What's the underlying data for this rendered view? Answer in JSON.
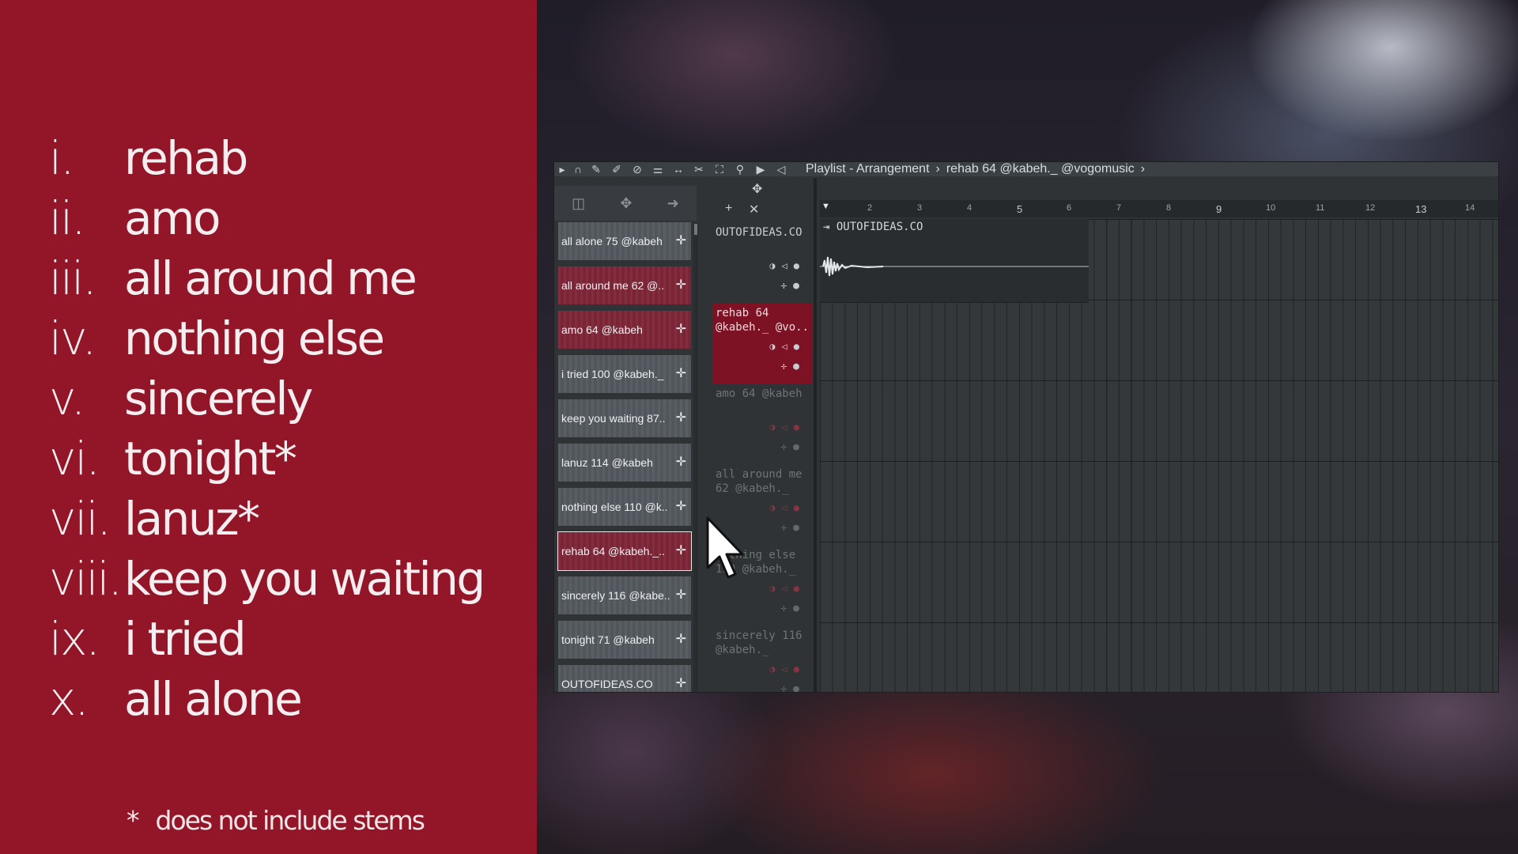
{
  "tracklist": [
    {
      "num": "i.",
      "name": "rehab"
    },
    {
      "num": "ii.",
      "name": "amo"
    },
    {
      "num": "iii.",
      "name": "all around me"
    },
    {
      "num": "iv.",
      "name": "nothing else"
    },
    {
      "num": "v.",
      "name": "sincerely"
    },
    {
      "num": "vi.",
      "name": "tonight*"
    },
    {
      "num": "vii.",
      "name": "lanuz*"
    },
    {
      "num": "viii.",
      "name": "keep you waiting"
    },
    {
      "num": "ix.",
      "name": "i tried"
    },
    {
      "num": "x.",
      "name": "all alone"
    }
  ],
  "footnote": {
    "star": "*",
    "text": "does not include stems"
  },
  "daw": {
    "toolbar": {
      "title": "Playlist - Arrangement",
      "arrangement": "rehab 64 @kabeh._ @vogomusic",
      "separator": "›"
    },
    "patterns": [
      {
        "name": "all alone 75 @kabeh",
        "red": false
      },
      {
        "name": "all around me 62 @..",
        "red": true
      },
      {
        "name": "amo 64 @kabeh",
        "red": true
      },
      {
        "name": "i tried 100 @kabeh._",
        "red": false
      },
      {
        "name": "keep you waiting 87..",
        "red": false
      },
      {
        "name": "lanuz 114 @kabeh",
        "red": false
      },
      {
        "name": "nothing else 110 @k..",
        "red": false
      },
      {
        "name": "rehab 64 @kabeh._..",
        "red": true,
        "selected": true
      },
      {
        "name": "sincerely 116 @kabe..",
        "red": false
      },
      {
        "name": "tonight 71 @kabeh",
        "red": false
      },
      {
        "name": "OUTOFIDEAS.CO",
        "red": false
      }
    ],
    "tracks": [
      {
        "label": "OUTOFIDEAS.CO",
        "state": "normal"
      },
      {
        "label": "rehab 64 @kabeh._ @vo..",
        "state": "active"
      },
      {
        "label": "amo 64 @kabeh",
        "state": "dim"
      },
      {
        "label": "all around me 62 @kabeh._",
        "state": "dim"
      },
      {
        "label": "nothing else 110 @kabeh._",
        "state": "dim"
      },
      {
        "label": "sincerely 116 @kabeh._",
        "state": "dim"
      }
    ],
    "clip_label": "OUTOFIDEAS.CO",
    "ruler": [
      "2",
      "3",
      "4",
      "5",
      "6",
      "7",
      "8",
      "9",
      "10",
      "11",
      "12",
      "13",
      "14"
    ],
    "ruler_big": [
      "5",
      "9",
      "13"
    ]
  }
}
